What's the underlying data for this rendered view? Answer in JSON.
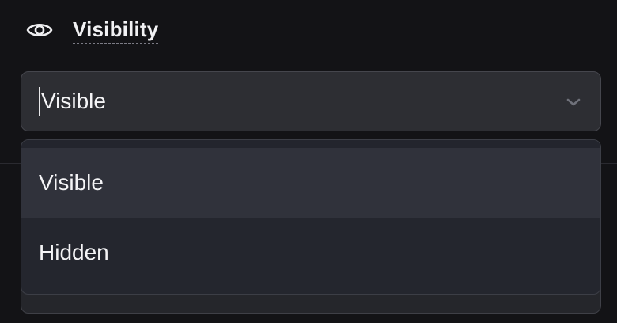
{
  "header": {
    "icon": "eye-icon",
    "label": "Visibility"
  },
  "select": {
    "value": "Visible",
    "icon": "chevron-down-icon"
  },
  "menu": {
    "options": [
      {
        "label": "Visible",
        "highlighted": true
      },
      {
        "label": "Hidden",
        "highlighted": false
      }
    ]
  },
  "colors": {
    "background": "#131316",
    "field": "#2d2e33",
    "menu": "#24262e",
    "menu_highlight": "#30323b"
  }
}
